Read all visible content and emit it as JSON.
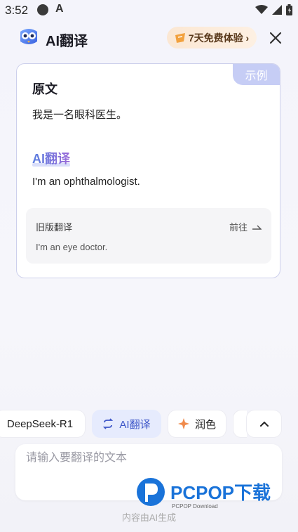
{
  "status": {
    "time": "3:52",
    "a_label": "A"
  },
  "header": {
    "title": "AI翻译",
    "trial_label": "7天免费体验 ›"
  },
  "card": {
    "example_tag": "示例",
    "source_heading": "原文",
    "source_text": "我是一名眼科医生。",
    "ai_heading": "AI翻译",
    "ai_text": "I'm an ophthalmologist.",
    "old_title": "旧版翻译",
    "old_goto": "前往",
    "old_text": "I'm an eye doctor."
  },
  "models": [
    {
      "label": "DeepSeek-R1"
    },
    {
      "label": "AI翻译"
    },
    {
      "label": "润色"
    }
  ],
  "input": {
    "placeholder": "请输入要翻译的文本"
  },
  "footer_note": "内容由AI生成",
  "watermark": {
    "brand": "PCPOP下载",
    "sub": "PCPOP Download"
  },
  "colors": {
    "accent": "#3d56c8",
    "chip_active_bg": "#e6ebfd",
    "example_tag": "#c6cdf5",
    "star": "#f08a4b"
  }
}
